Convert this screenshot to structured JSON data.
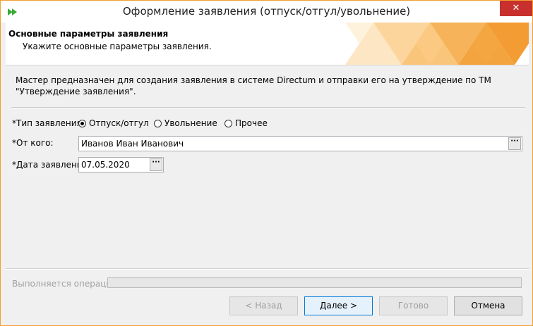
{
  "window": {
    "title": "Оформление заявления (отпуск/отгул/увольнение)",
    "close_glyph": "✕",
    "border_color": "#f0a030"
  },
  "header": {
    "title": "Основные параметры заявления",
    "subtitle": "Укажите основные параметры заявления."
  },
  "content": {
    "description": "Мастер предназначен для создания заявления в системе Directum и отправки его на утверждение по ТМ \"Утверждение заявления\".",
    "type_label": "*Тип заявления:",
    "type_options": [
      {
        "label": "Отпуск/отгул",
        "selected": true
      },
      {
        "label": "Увольнение",
        "selected": false
      },
      {
        "label": "Прочее",
        "selected": false
      }
    ],
    "from_label": "*От кого:",
    "from_value": "Иванов Иван Иванович",
    "date_label": "*Дата заявления:",
    "date_value": "07.05.2020",
    "ellipsis": "···"
  },
  "status": {
    "label": "Выполняется операция",
    "progress": 0
  },
  "buttons": {
    "back": "< Назад",
    "next": "Далее >",
    "finish": "Готово",
    "cancel": "Отмена"
  }
}
